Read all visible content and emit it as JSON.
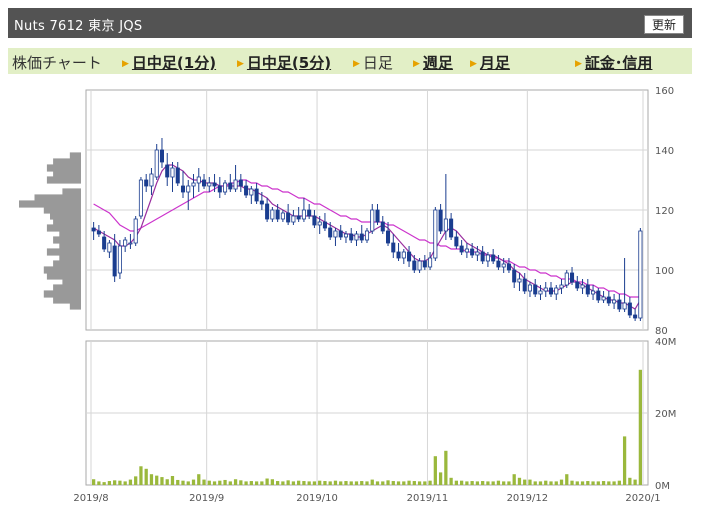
{
  "header": {
    "title": "Nuts  7612  東京 JQS",
    "refresh_label": "更新"
  },
  "tabs": [
    {
      "label": "株価チャート",
      "link": false,
      "arrow": false
    },
    {
      "label": "日中足(1分)",
      "link": true,
      "arrow": true
    },
    {
      "label": "日中足(5分)",
      "link": true,
      "arrow": true
    },
    {
      "label": "日足",
      "link": false,
      "arrow": true
    },
    {
      "label": "週足",
      "link": true,
      "arrow": true
    },
    {
      "label": "月足",
      "link": true,
      "arrow": true
    },
    {
      "label": "証金･信用",
      "link": true,
      "arrow": true
    }
  ],
  "colors": {
    "candle": "#1a3d8f",
    "ma_short": "#9a2fa0",
    "ma_long": "#cc33cc",
    "volume": "#9ab83c",
    "profile": "#999999"
  },
  "chart_data": {
    "type": "candlestick",
    "price_axis": {
      "ticks": [
        80,
        100,
        120,
        140,
        160
      ],
      "ylim": [
        80,
        160
      ]
    },
    "volume_axis": {
      "ticks": [
        "0M",
        "20M",
        "40M"
      ],
      "tick_values": [
        0,
        20,
        40
      ],
      "ylim": [
        0,
        40
      ],
      "unit": "M"
    },
    "x_labels": [
      "2019/8",
      "2019/9",
      "2019/10",
      "2019/11",
      "2019/12",
      "2020/1"
    ],
    "x_label_index": [
      0,
      22,
      43,
      64,
      83,
      105
    ],
    "x_gridline_index": [
      0,
      22,
      43,
      64,
      83,
      105,
      119
    ],
    "ohlc": [
      [
        114,
        116,
        110,
        113
      ],
      [
        113,
        115,
        111,
        112
      ],
      [
        111,
        113,
        106,
        107
      ],
      [
        106,
        110,
        104,
        109
      ],
      [
        108,
        112,
        96,
        98
      ],
      [
        99,
        110,
        97,
        108
      ],
      [
        108,
        111,
        106,
        110
      ],
      [
        109,
        112,
        107,
        109
      ],
      [
        109,
        118,
        108,
        117
      ],
      [
        118,
        131,
        117,
        130
      ],
      [
        130,
        132,
        126,
        128
      ],
      [
        128,
        134,
        125,
        132
      ],
      [
        131,
        142,
        130,
        140
      ],
      [
        140,
        144,
        134,
        136
      ],
      [
        135,
        139,
        128,
        131
      ],
      [
        131,
        136,
        126,
        134
      ],
      [
        134,
        136,
        128,
        129
      ],
      [
        128,
        133,
        124,
        126
      ],
      [
        126,
        130,
        120,
        128
      ],
      [
        128,
        132,
        124,
        129
      ],
      [
        129,
        134,
        126,
        131
      ],
      [
        130,
        132,
        127,
        128
      ],
      [
        128,
        131,
        126,
        129
      ],
      [
        129,
        132,
        126,
        128
      ],
      [
        128,
        131,
        124,
        126
      ],
      [
        126,
        130,
        125,
        129
      ],
      [
        129,
        132,
        126,
        127
      ],
      [
        127,
        135,
        126,
        130
      ],
      [
        130,
        132,
        126,
        128
      ],
      [
        128,
        130,
        124,
        125
      ],
      [
        125,
        128,
        122,
        127
      ],
      [
        127,
        129,
        122,
        123
      ],
      [
        123,
        126,
        120,
        122
      ],
      [
        122,
        124,
        116,
        117
      ],
      [
        117,
        121,
        116,
        120
      ],
      [
        120,
        122,
        116,
        117
      ],
      [
        117,
        120,
        116,
        119
      ],
      [
        119,
        122,
        115,
        116
      ],
      [
        116,
        120,
        115,
        118
      ],
      [
        118,
        121,
        116,
        117
      ],
      [
        117,
        124,
        116,
        120
      ],
      [
        120,
        122,
        117,
        118
      ],
      [
        118,
        120,
        114,
        115
      ],
      [
        115,
        118,
        112,
        116
      ],
      [
        116,
        119,
        113,
        114
      ],
      [
        114,
        116,
        110,
        111
      ],
      [
        111,
        114,
        108,
        113
      ],
      [
        113,
        115,
        110,
        111
      ],
      [
        111,
        113,
        109,
        112
      ],
      [
        112,
        114,
        109,
        110
      ],
      [
        110,
        113,
        108,
        112
      ],
      [
        112,
        115,
        109,
        110
      ],
      [
        110,
        114,
        109,
        113
      ],
      [
        113,
        122,
        112,
        120
      ],
      [
        120,
        122,
        115,
        116
      ],
      [
        116,
        118,
        112,
        113
      ],
      [
        113,
        116,
        108,
        109
      ],
      [
        109,
        112,
        104,
        106
      ],
      [
        106,
        109,
        103,
        104
      ],
      [
        104,
        107,
        102,
        106
      ],
      [
        106,
        108,
        101,
        103
      ],
      [
        103,
        105,
        99,
        100
      ],
      [
        100,
        104,
        99,
        103
      ],
      [
        103,
        105,
        100,
        101
      ],
      [
        101,
        106,
        100,
        104
      ],
      [
        104,
        121,
        103,
        120
      ],
      [
        120,
        122,
        112,
        113
      ],
      [
        113,
        132,
        110,
        117
      ],
      [
        117,
        119,
        110,
        111
      ],
      [
        111,
        113,
        107,
        108
      ],
      [
        108,
        110,
        105,
        106
      ],
      [
        106,
        109,
        104,
        107
      ],
      [
        107,
        109,
        104,
        105
      ],
      [
        105,
        108,
        103,
        106
      ],
      [
        106,
        108,
        102,
        103
      ],
      [
        103,
        106,
        101,
        105
      ],
      [
        105,
        107,
        102,
        103
      ],
      [
        103,
        105,
        100,
        101
      ],
      [
        101,
        104,
        99,
        102
      ],
      [
        102,
        104,
        99,
        100
      ],
      [
        100,
        102,
        94,
        96
      ],
      [
        96,
        99,
        93,
        97
      ],
      [
        97,
        99,
        92,
        93
      ],
      [
        93,
        96,
        91,
        95
      ],
      [
        95,
        97,
        91,
        92
      ],
      [
        92,
        95,
        90,
        93
      ],
      [
        93,
        96,
        91,
        94
      ],
      [
        94,
        96,
        91,
        92
      ],
      [
        92,
        95,
        90,
        94
      ],
      [
        94,
        97,
        92,
        95
      ],
      [
        95,
        100,
        94,
        99
      ],
      [
        99,
        101,
        95,
        96
      ],
      [
        96,
        98,
        93,
        94
      ],
      [
        94,
        97,
        92,
        95
      ],
      [
        95,
        97,
        91,
        92
      ],
      [
        92,
        95,
        90,
        93
      ],
      [
        93,
        94,
        89,
        90
      ],
      [
        90,
        93,
        89,
        91
      ],
      [
        91,
        93,
        88,
        89
      ],
      [
        89,
        92,
        87,
        90
      ],
      [
        90,
        92,
        86,
        87
      ],
      [
        87,
        104,
        86,
        89
      ],
      [
        89,
        91,
        84,
        85
      ],
      [
        85,
        87,
        83,
        84
      ],
      [
        84,
        114,
        83,
        113
      ]
    ],
    "ma_short": [
      114,
      113,
      112,
      111,
      110,
      108,
      108,
      109,
      111,
      114,
      119,
      124,
      129,
      133,
      135,
      135,
      134,
      133,
      131,
      130,
      130,
      129,
      129,
      129,
      128,
      128,
      128,
      128,
      128,
      127,
      127,
      126,
      125,
      124,
      122,
      121,
      120,
      119,
      118,
      118,
      118,
      118,
      118,
      117,
      116,
      115,
      114,
      113,
      112,
      112,
      111,
      111,
      112,
      113,
      114,
      115,
      114,
      112,
      110,
      108,
      106,
      104,
      103,
      103,
      104,
      107,
      110,
      113,
      114,
      113,
      111,
      109,
      108,
      107,
      106,
      105,
      105,
      104,
      103,
      102,
      100,
      99,
      97,
      96,
      95,
      94,
      93,
      93,
      93,
      94,
      95,
      96,
      96,
      95,
      94,
      93,
      92,
      91,
      90,
      90,
      89,
      89,
      88,
      87,
      90
    ],
    "ma_long": [
      122,
      121,
      120,
      119,
      117,
      115,
      114,
      113,
      113,
      114,
      115,
      116,
      117,
      118,
      119,
      120,
      121,
      122,
      123,
      124,
      125,
      126,
      126,
      127,
      128,
      128,
      129,
      129,
      130,
      130,
      129,
      129,
      128,
      128,
      127,
      127,
      126,
      126,
      125,
      124,
      124,
      123,
      122,
      122,
      121,
      120,
      119,
      118,
      118,
      117,
      117,
      116,
      116,
      116,
      116,
      116,
      115,
      115,
      114,
      113,
      112,
      111,
      110,
      110,
      109,
      109,
      108,
      108,
      107,
      107,
      107,
      106,
      106,
      106,
      105,
      105,
      104,
      104,
      103,
      103,
      102,
      101,
      101,
      100,
      100,
      99,
      99,
      98,
      98,
      97,
      97,
      97,
      96,
      96,
      95,
      95,
      94,
      94,
      93,
      93,
      92,
      92,
      91,
      91,
      91
    ],
    "volume": [
      1.6,
      1.0,
      0.8,
      1.1,
      1.3,
      1.2,
      1.0,
      1.5,
      2.4,
      5.2,
      4.5,
      3.0,
      2.6,
      2.2,
      1.6,
      2.5,
      1.4,
      1.2,
      1.0,
      1.5,
      3.0,
      1.5,
      1.2,
      1.0,
      1.2,
      1.4,
      1.0,
      1.6,
      1.3,
      1.0,
      1.1,
      1.0,
      1.0,
      1.8,
      1.6,
      1.1,
      1.0,
      1.3,
      1.0,
      1.2,
      1.1,
      1.0,
      1.0,
      1.2,
      1.1,
      1.0,
      1.2,
      1.0,
      1.1,
      1.0,
      1.0,
      1.1,
      1.0,
      1.5,
      1.0,
      1.0,
      1.3,
      1.1,
      1.0,
      1.0,
      1.2,
      1.1,
      1.0,
      1.0,
      1.2,
      8.0,
      3.5,
      9.5,
      2.0,
      1.2,
      1.2,
      1.0,
      1.1,
      1.0,
      1.1,
      1.0,
      1.0,
      1.2,
      1.0,
      1.0,
      3.0,
      2.0,
      1.5,
      1.5,
      1.0,
      1.0,
      1.2,
      1.0,
      1.0,
      1.5,
      3.0,
      1.2,
      1.0,
      1.0,
      1.1,
      1.0,
      1.0,
      1.1,
      1.0,
      1.0,
      1.2,
      13.5,
      2.0,
      1.5,
      32.0
    ],
    "price_profile": [
      [
        138,
        0.18
      ],
      [
        136,
        0.45
      ],
      [
        134,
        0.55
      ],
      [
        132,
        0.45
      ],
      [
        130,
        0.55
      ],
      [
        126,
        0.3
      ],
      [
        124,
        0.75
      ],
      [
        122,
        1.0
      ],
      [
        120,
        0.6
      ],
      [
        118,
        0.5
      ],
      [
        116,
        0.45
      ],
      [
        114,
        0.55
      ],
      [
        112,
        0.35
      ],
      [
        110,
        0.45
      ],
      [
        108,
        0.35
      ],
      [
        106,
        0.55
      ],
      [
        104,
        0.35
      ],
      [
        102,
        0.45
      ],
      [
        100,
        0.6
      ],
      [
        98,
        0.55
      ],
      [
        96,
        0.3
      ],
      [
        94,
        0.45
      ],
      [
        92,
        0.6
      ],
      [
        90,
        0.45
      ],
      [
        88,
        0.18
      ]
    ]
  }
}
